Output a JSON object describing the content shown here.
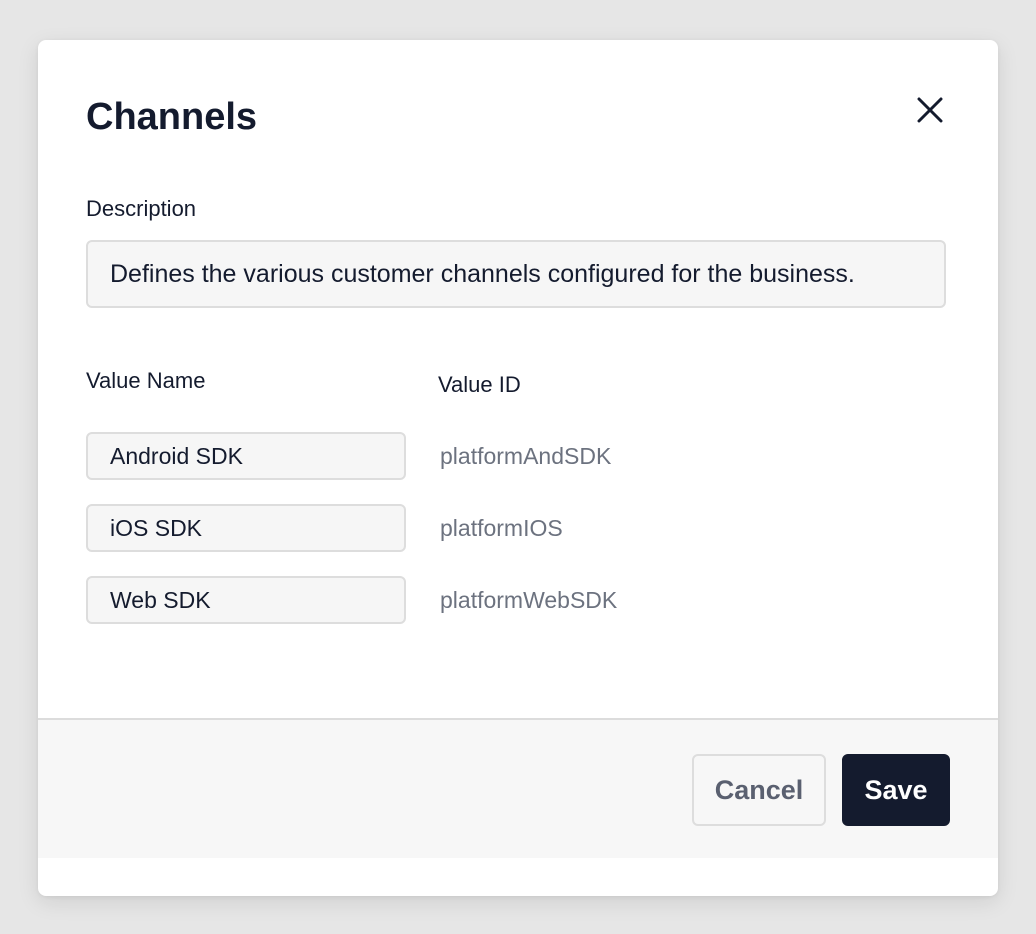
{
  "dialog": {
    "title": "Channels",
    "close_icon": "close-icon"
  },
  "description": {
    "label": "Description",
    "value": "Defines the various customer channels configured for the business."
  },
  "values_table": {
    "headers": {
      "name": "Value Name",
      "id": "Value ID"
    },
    "rows": [
      {
        "name": "Android SDK",
        "id": "platformAndSDK"
      },
      {
        "name": "iOS SDK",
        "id": "platformIOS"
      },
      {
        "name": "Web SDK",
        "id": "platformWebSDK"
      }
    ]
  },
  "footer": {
    "cancel_label": "Cancel",
    "save_label": "Save"
  },
  "colors": {
    "page_background": "#e6e6e6",
    "text_primary": "#141b2e",
    "text_secondary": "#6c727f",
    "primary_button": "#141b2e",
    "input_background": "#f6f6f6",
    "border": "#dddddd"
  }
}
